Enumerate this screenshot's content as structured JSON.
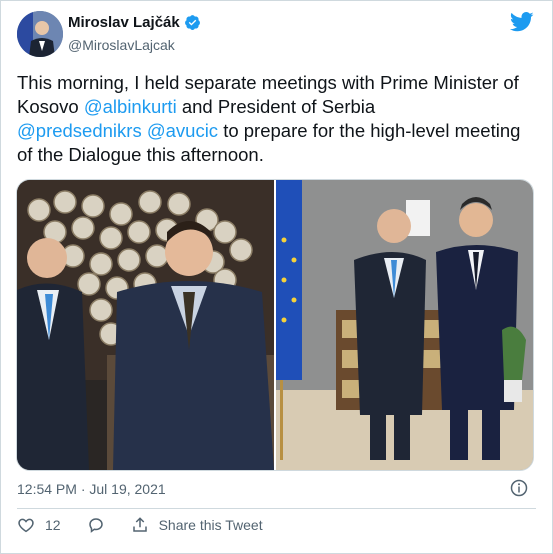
{
  "author": {
    "name": "Miroslav Lajčák",
    "handle": "@MiroslavLajcak"
  },
  "tweet": {
    "text_part1": "This morning, I held separate meetings with Prime Minister of Kosovo ",
    "mention1": "@albinkurti",
    "text_part2": " and President of Serbia ",
    "mention2": "@predsednikrs",
    "text_part3": " ",
    "mention3": "@avucic",
    "text_part4": " to prepare for the high-level meeting of the Dialogue this afternoon."
  },
  "meta": {
    "timestamp": "12:54 PM · Jul 19, 2021"
  },
  "actions": {
    "like_count": "12",
    "share_label": "Share this Tweet"
  },
  "colors": {
    "accent": "#1d9bf0",
    "text": "#0f1419",
    "muted": "#536471"
  },
  "icons": [
    "verified-badge-icon",
    "twitter-bird-icon",
    "info-icon",
    "heart-icon",
    "reply-icon",
    "share-icon"
  ]
}
